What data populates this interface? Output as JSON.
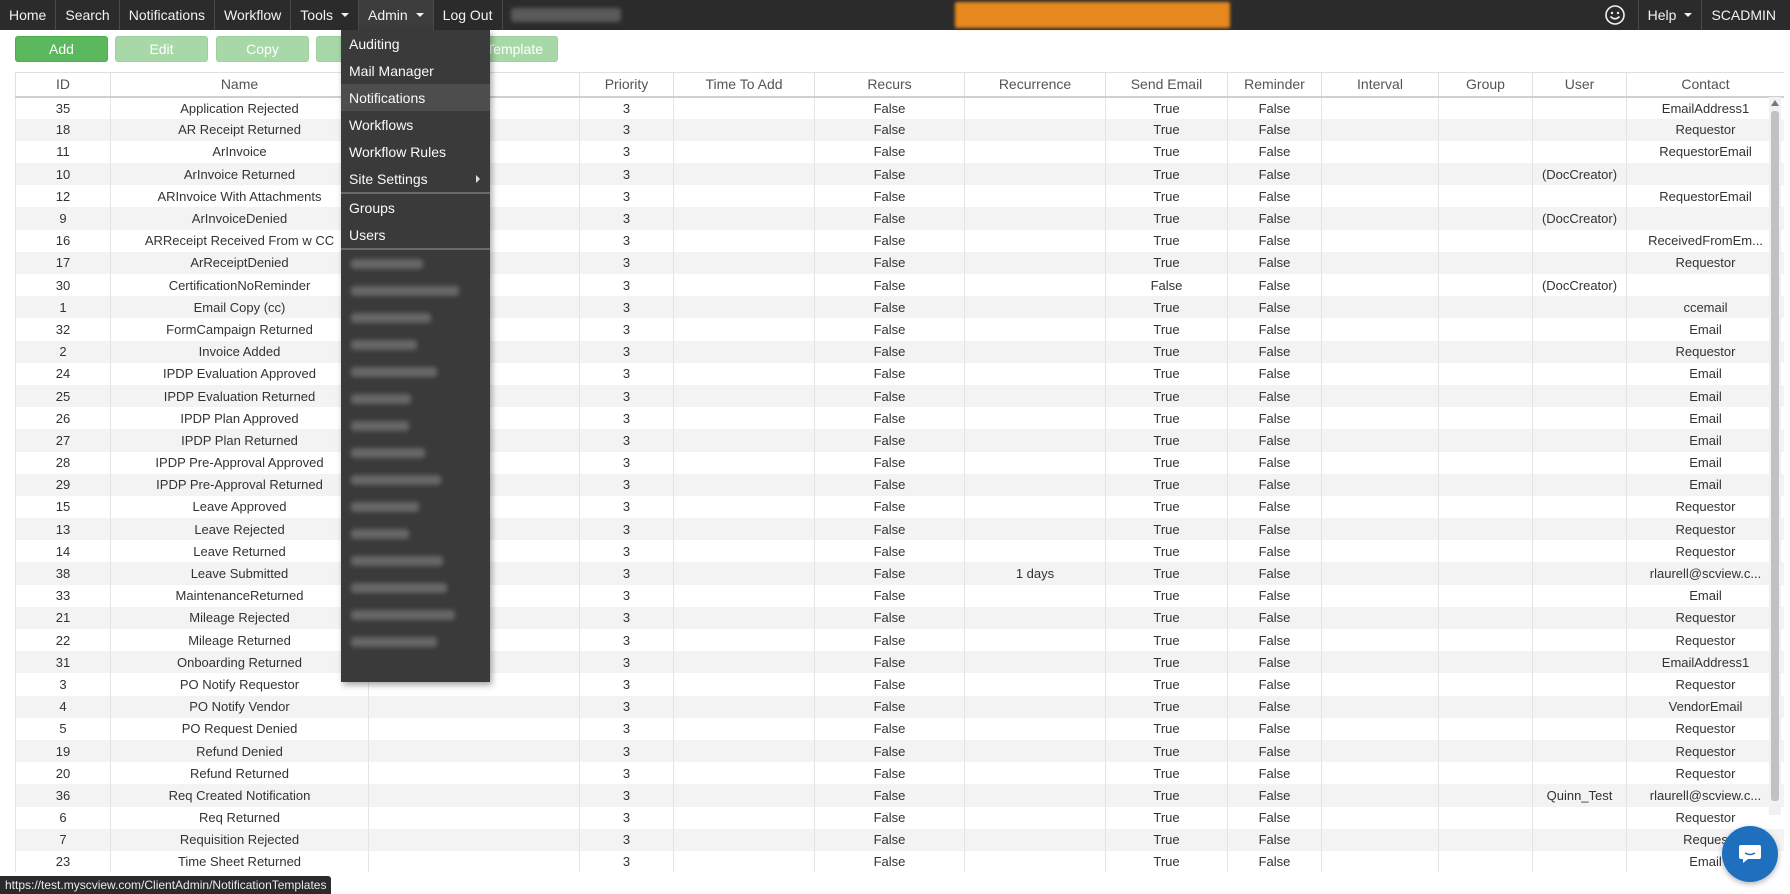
{
  "nav": {
    "items": [
      {
        "label": "Home",
        "dropdown": false
      },
      {
        "label": "Search",
        "dropdown": false
      },
      {
        "label": "Notifications",
        "dropdown": false
      },
      {
        "label": "Workflow",
        "dropdown": false
      },
      {
        "label": "Tools",
        "dropdown": true
      },
      {
        "label": "Admin",
        "dropdown": true
      },
      {
        "label": "Log Out",
        "dropdown": false
      }
    ],
    "help": "Help",
    "user": "SCADMIN",
    "banner_color": "#e8891f"
  },
  "toolbar": {
    "add": "Add",
    "edit": "Edit",
    "copy": "Copy",
    "template": "Template"
  },
  "admin_menu": {
    "items": [
      "Auditing",
      "Mail Manager",
      "Notifications",
      "Workflows",
      "Workflow Rules",
      "Site Settings"
    ],
    "items2": [
      "Groups",
      "Users"
    ],
    "hovered": "Notifications"
  },
  "table": {
    "columns": [
      "ID",
      "Name",
      "",
      "Priority",
      "Time To Add",
      "Recurs",
      "Recurrence",
      "Send Email",
      "Reminder",
      "Interval",
      "Group",
      "User",
      "Contact"
    ],
    "rows": [
      [
        "35",
        "Application Rejected",
        "",
        "3",
        "",
        "False",
        "",
        "True",
        "False",
        "",
        "",
        "",
        "EmailAddress1"
      ],
      [
        "18",
        "AR Receipt Returned",
        "",
        "3",
        "",
        "False",
        "",
        "True",
        "False",
        "",
        "",
        "",
        "Requestor"
      ],
      [
        "11",
        "ArInvoice",
        "",
        "3",
        "",
        "False",
        "",
        "True",
        "False",
        "",
        "",
        "",
        "RequestorEmail"
      ],
      [
        "10",
        "ArInvoice Returned",
        "",
        "3",
        "",
        "False",
        "",
        "True",
        "False",
        "",
        "",
        "(DocCreator)",
        ""
      ],
      [
        "12",
        "ARInvoice With Attachments",
        "",
        "3",
        "",
        "False",
        "",
        "True",
        "False",
        "",
        "",
        "",
        "RequestorEmail"
      ],
      [
        "9",
        "ArInvoiceDenied",
        "",
        "3",
        "",
        "False",
        "",
        "True",
        "False",
        "",
        "",
        "(DocCreator)",
        ""
      ],
      [
        "16",
        "ARReceipt Received From w CC",
        "",
        "3",
        "",
        "False",
        "",
        "True",
        "False",
        "",
        "",
        "",
        "ReceivedFromEm..."
      ],
      [
        "17",
        "ArReceiptDenied",
        "",
        "3",
        "",
        "False",
        "",
        "True",
        "False",
        "",
        "",
        "",
        "Requestor"
      ],
      [
        "30",
        "CertificationNoReminder",
        "",
        "3",
        "",
        "False",
        "",
        "False",
        "False",
        "",
        "",
        "(DocCreator)",
        ""
      ],
      [
        "1",
        "Email Copy (cc)",
        "",
        "3",
        "",
        "False",
        "",
        "True",
        "False",
        "",
        "",
        "",
        "ccemail"
      ],
      [
        "32",
        "FormCampaign Returned",
        "",
        "3",
        "",
        "False",
        "",
        "True",
        "False",
        "",
        "",
        "",
        "Email"
      ],
      [
        "2",
        "Invoice Added",
        "",
        "3",
        "",
        "False",
        "",
        "True",
        "False",
        "",
        "",
        "",
        "Requestor"
      ],
      [
        "24",
        "IPDP Evaluation Approved",
        "",
        "3",
        "",
        "False",
        "",
        "True",
        "False",
        "",
        "",
        "",
        "Email"
      ],
      [
        "25",
        "IPDP Evaluation Returned",
        "",
        "3",
        "",
        "False",
        "",
        "True",
        "False",
        "",
        "",
        "",
        "Email"
      ],
      [
        "26",
        "IPDP Plan Approved",
        "",
        "3",
        "",
        "False",
        "",
        "True",
        "False",
        "",
        "",
        "",
        "Email"
      ],
      [
        "27",
        "IPDP Plan Returned",
        "",
        "3",
        "",
        "False",
        "",
        "True",
        "False",
        "",
        "",
        "",
        "Email"
      ],
      [
        "28",
        "IPDP Pre-Approval Approved",
        "",
        "3",
        "",
        "False",
        "",
        "True",
        "False",
        "",
        "",
        "",
        "Email"
      ],
      [
        "29",
        "IPDP Pre-Approval Returned",
        "",
        "3",
        "",
        "False",
        "",
        "True",
        "False",
        "",
        "",
        "",
        "Email"
      ],
      [
        "15",
        "Leave Approved",
        "",
        "3",
        "",
        "False",
        "",
        "True",
        "False",
        "",
        "",
        "",
        "Requestor"
      ],
      [
        "13",
        "Leave Rejected",
        "",
        "3",
        "",
        "False",
        "",
        "True",
        "False",
        "",
        "",
        "",
        "Requestor"
      ],
      [
        "14",
        "Leave Returned",
        "",
        "3",
        "",
        "False",
        "",
        "True",
        "False",
        "",
        "",
        "",
        "Requestor"
      ],
      [
        "38",
        "Leave Submitted",
        "",
        "3",
        "",
        "False",
        "1 days",
        "True",
        "False",
        "",
        "",
        "",
        "rlaurell@scview.c..."
      ],
      [
        "33",
        "MaintenanceReturned",
        "",
        "3",
        "",
        "False",
        "",
        "True",
        "False",
        "",
        "",
        "",
        "Email"
      ],
      [
        "21",
        "Mileage Rejected",
        "",
        "3",
        "",
        "False",
        "",
        "True",
        "False",
        "",
        "",
        "",
        "Requestor"
      ],
      [
        "22",
        "Mileage Returned",
        "",
        "3",
        "",
        "False",
        "",
        "True",
        "False",
        "",
        "",
        "",
        "Requestor"
      ],
      [
        "31",
        "Onboarding Returned",
        "",
        "3",
        "",
        "False",
        "",
        "True",
        "False",
        "",
        "",
        "",
        "EmailAddress1"
      ],
      [
        "3",
        "PO Notify Requestor",
        "",
        "3",
        "",
        "False",
        "",
        "True",
        "False",
        "",
        "",
        "",
        "Requestor"
      ],
      [
        "4",
        "PO Notify Vendor",
        "",
        "3",
        "",
        "False",
        "",
        "True",
        "False",
        "",
        "",
        "",
        "VendorEmail"
      ],
      [
        "5",
        "PO Request Denied",
        "",
        "3",
        "",
        "False",
        "",
        "True",
        "False",
        "",
        "",
        "",
        "Requestor"
      ],
      [
        "19",
        "Refund Denied",
        "",
        "3",
        "",
        "False",
        "",
        "True",
        "False",
        "",
        "",
        "",
        "Requestor"
      ],
      [
        "20",
        "Refund Returned",
        "",
        "3",
        "",
        "False",
        "",
        "True",
        "False",
        "",
        "",
        "",
        "Requestor"
      ],
      [
        "36",
        "Req Created Notification",
        "",
        "3",
        "",
        "False",
        "",
        "True",
        "False",
        "",
        "",
        "Quinn_Test",
        "rlaurell@scview.c..."
      ],
      [
        "6",
        "Req Returned",
        "",
        "3",
        "",
        "False",
        "",
        "True",
        "False",
        "",
        "",
        "",
        "Requestor"
      ],
      [
        "7",
        "Requisition Rejected",
        "",
        "3",
        "",
        "False",
        "",
        "True",
        "False",
        "",
        "",
        "",
        "Reques"
      ],
      [
        "23",
        "Time Sheet Returned",
        "",
        "3",
        "",
        "False",
        "",
        "True",
        "False",
        "",
        "",
        "",
        "Email"
      ]
    ]
  },
  "status_url": "https://test.myscview.com/ClientAdmin/NotificationTemplates"
}
